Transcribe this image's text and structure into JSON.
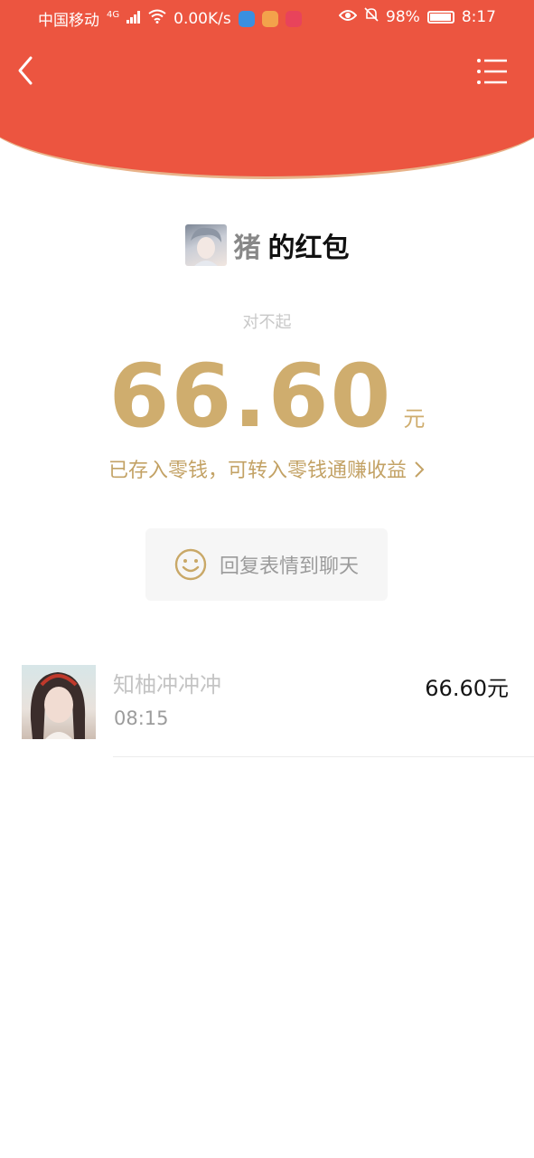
{
  "status_bar": {
    "carrier": "中国移动",
    "network": "4G",
    "speed": "0.00K/s",
    "battery": "98%",
    "time": "8:17"
  },
  "header": {
    "background_color": "#ec5540",
    "back_icon": "chevron-left-icon",
    "menu_icon": "list-menu-icon"
  },
  "packet": {
    "sender_name": "猪",
    "title_suffix": "的红包",
    "message": "对不起",
    "amount": "66.60",
    "unit": "元",
    "deposit_text": "已存入零钱，可转入零钱通赚收益",
    "accent_color": "#cfad6e"
  },
  "reply_button": {
    "label": "回复表情到聊天",
    "icon": "smiley-icon"
  },
  "receivers": [
    {
      "name": "知柚冲冲冲",
      "time": "08:15",
      "amount": "66.60元"
    }
  ]
}
